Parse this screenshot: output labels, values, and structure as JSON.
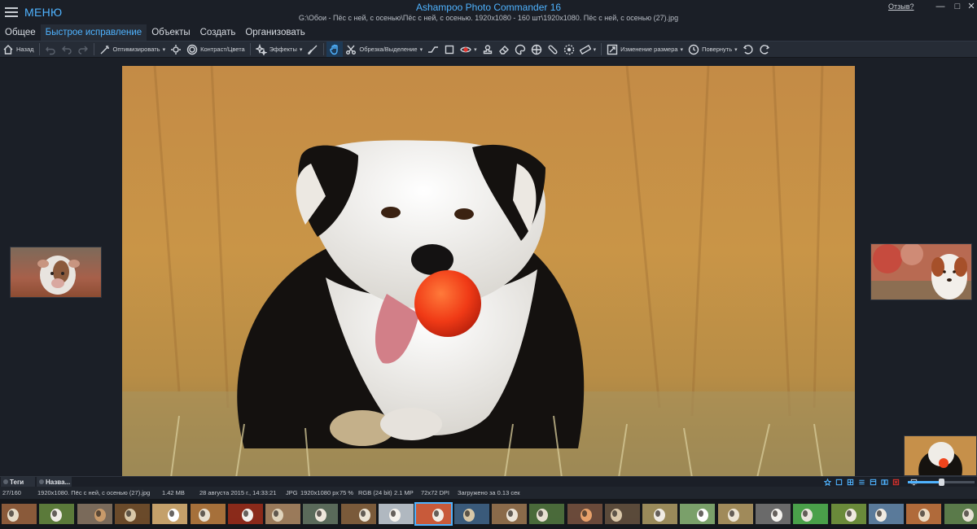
{
  "window": {
    "menu_label": "МЕНЮ",
    "app_title": "Ashampoo Photo Commander 16",
    "file_path": "G:\\Обои - Пёс с ней, с осенью\\Пёс с ней, с осенью. 1920x1080 - 160 шт\\1920x1080. Пёс с ней, с осенью (27).jpg",
    "help_link": "Отзыв?",
    "controls": [
      "minimize-icon",
      "maximize-icon",
      "close-icon"
    ]
  },
  "tabs": [
    {
      "label": "Общее",
      "active": false
    },
    {
      "label": "Быстрое исправление",
      "active": true
    },
    {
      "label": "Объекты",
      "active": false
    },
    {
      "label": "Создать",
      "active": false
    },
    {
      "label": "Организовать",
      "active": false
    }
  ],
  "toolbar": {
    "back_label": "Назад",
    "optimize_label": "Оптимизировать",
    "contrast_label": "Контраст/Цвета",
    "effects_label": "Эффекты",
    "crop_label": "Обрезка/Выделение",
    "resize_label": "Изменение размера",
    "rotate_label": "Повернуть"
  },
  "panels": {
    "tags_label": "Теги",
    "names_label": "Назва..."
  },
  "zoom": {
    "level": 0.5
  },
  "status": {
    "index": "27/160",
    "filename": "1920x1080. Пёс с ней, с осенью (27).jpg",
    "filesize": "1.42 MB",
    "date": "28 августа 2015 г., 14:33:21",
    "format": "JPG",
    "dimensions": "1920x1080 px",
    "zoom": "75 %",
    "color": "RGB (24 bit)",
    "megapixels": "2.1 MP",
    "dpi": "72x72 DPI",
    "load_time": "Загружено за 0.13 сек"
  },
  "colors": {
    "accent": "#4fb3ff",
    "background": "#1b1f27",
    "toolbar": "#262c36"
  },
  "filmstrip": {
    "count": 26,
    "current_index": 11
  }
}
